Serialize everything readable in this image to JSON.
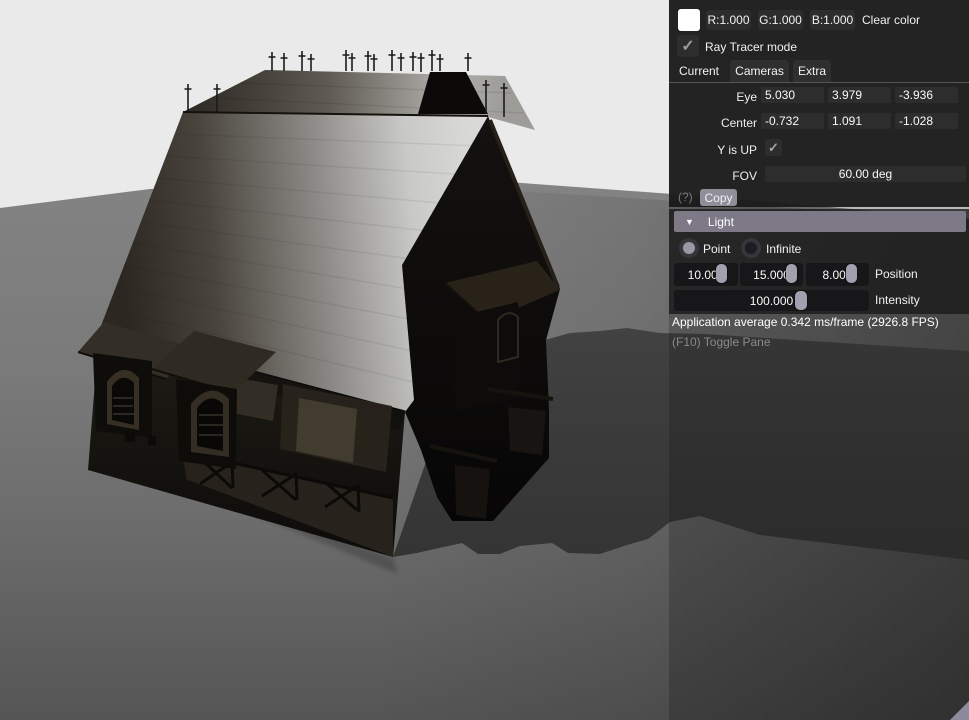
{
  "panel": {
    "color_row": {
      "swatch_color": "#ffffff",
      "r_label": "R:1.000",
      "g_label": "G:1.000",
      "b_label": "B:1.000",
      "clear_label": "Clear color"
    },
    "ray_tracer": {
      "label": "Ray Tracer mode",
      "checked": true,
      "check_glyph": "✓"
    },
    "tabs": [
      {
        "label": "Current",
        "active": true
      },
      {
        "label": "Cameras",
        "active": false
      },
      {
        "label": "Extra",
        "active": false
      }
    ],
    "camera": {
      "eye_label": "Eye",
      "eye": [
        "5.030",
        "3.979",
        "-3.936"
      ],
      "center_label": "Center",
      "center": [
        "-0.732",
        "1.091",
        "-1.028"
      ],
      "y_up_label": "Y is UP",
      "y_up_checked": true,
      "y_up_glyph": "✓",
      "fov_label": "FOV",
      "fov_value": "60.00 deg"
    },
    "help_label": "(?)",
    "copy_label": "Copy",
    "light": {
      "header": "Light",
      "collapse_glyph": "▼",
      "point_label": "Point",
      "infinite_label": "Infinite",
      "point_selected": true,
      "position": [
        "10.000",
        "15.000",
        "8.000"
      ],
      "position_label": "Position",
      "intensity": "100.000",
      "intensity_label": "Intensity"
    },
    "stats": "Application average 0.342 ms/frame (2926.8 FPS)",
    "toggle_hint": "(F10) Toggle Pane",
    "colors": {
      "pane_bg": "#1a1a1a",
      "field_bg": "#2d2d2d",
      "dark_field_bg": "#17171a",
      "light_header_bg": "#7d7987",
      "slider_pill": "#a39fae",
      "copy_button_bg": "#8f8e99",
      "resize_grip": "#8d8b9b",
      "hint_text": "#8a8a8a"
    }
  },
  "scene": {
    "description": "Dark timber-framed house with steep shingled roof, roof finial spikes, two arched dormers, hanging signs, on gray ground plane casting long shadow to the right",
    "colors": {
      "sky": "#eaeaea",
      "ground_near": "#7c7c7c",
      "ground_far": "#4f4f4f",
      "shadow": "#3a3a3a",
      "roof_highlight": "#d8d8d6",
      "roof_dark": "#2c2821",
      "house_dark": "#0d0c0a"
    }
  }
}
